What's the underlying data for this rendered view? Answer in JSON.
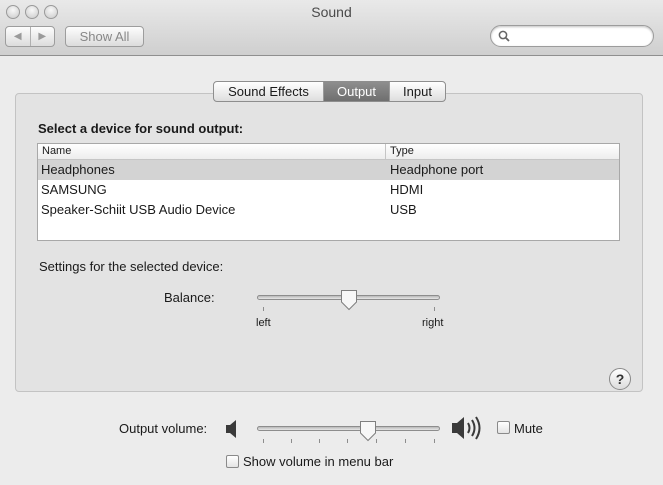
{
  "window": {
    "title": "Sound"
  },
  "toolbar": {
    "back_icon": "left-triangle-icon",
    "forward_icon": "right-triangle-icon",
    "show_all_label": "Show All",
    "search": {
      "value": "",
      "placeholder": ""
    }
  },
  "tabs": [
    {
      "label": "Sound Effects",
      "selected": false
    },
    {
      "label": "Output",
      "selected": true
    },
    {
      "label": "Input",
      "selected": false
    }
  ],
  "output": {
    "select_title": "Select a device for sound output:",
    "columns": {
      "name": "Name",
      "type": "Type"
    },
    "devices": [
      {
        "name": "Headphones",
        "type": "Headphone port",
        "selected": true
      },
      {
        "name": "SAMSUNG",
        "type": "HDMI",
        "selected": false
      },
      {
        "name": "Speaker-Schiit USB Audio Device",
        "type": "USB",
        "selected": false
      }
    ],
    "settings_label": "Settings for the selected device:",
    "balance": {
      "label": "Balance:",
      "left_label": "left",
      "right_label": "right",
      "value": 0.5
    }
  },
  "volume": {
    "label": "Output volume:",
    "level": 0.62,
    "mute_label": "Mute",
    "mute_checked": false,
    "show_in_menubar_label": "Show volume in menu bar",
    "show_in_menubar_checked": false
  },
  "colors": {
    "selected_row": "#d3d3d3",
    "selected_tab": "#7a7a7a"
  }
}
